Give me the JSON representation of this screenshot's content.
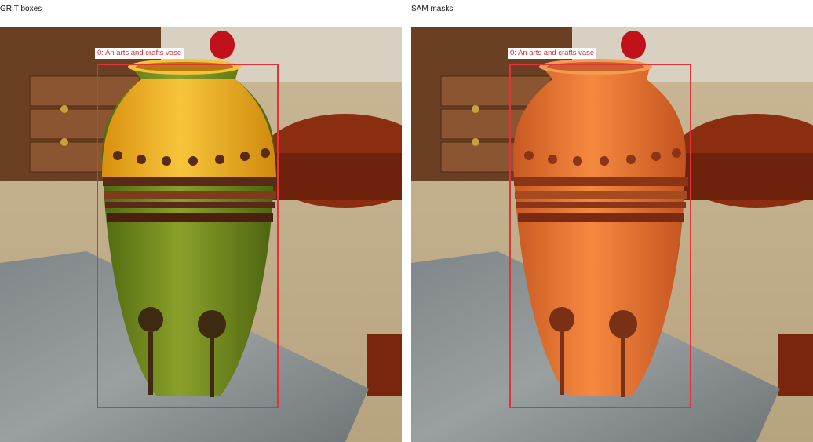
{
  "panels": [
    {
      "title": "GRIT boxes",
      "mask_applied": false
    },
    {
      "title": "SAM masks",
      "mask_applied": true
    }
  ],
  "detection": {
    "label": "0: An arts and crafts vase"
  },
  "colors": {
    "box_outline": "#e0333a",
    "label_text": "#d12a30",
    "vase_neck": "#f0b21a",
    "vase_body": "#6f8a1a",
    "vase_band": "#5a2a18",
    "mask_overlay": "#f07a3a"
  }
}
